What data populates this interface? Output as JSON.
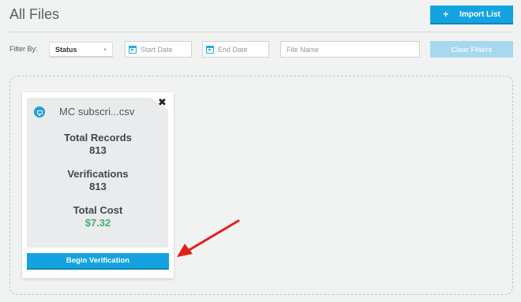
{
  "header": {
    "title": "All Files",
    "import_label": "Import List",
    "import_icon": "plus-icon"
  },
  "filters": {
    "label": "Filter By:",
    "status_value": "Status",
    "start_date_placeholder": "Start Date",
    "end_date_placeholder": "End Date",
    "file_name_placeholder": "File Name",
    "clear_label": "Clear Filters"
  },
  "card": {
    "file_name": "MC subscri...csv",
    "total_records_label": "Total Records",
    "total_records_value": "813",
    "verifications_label": "Verifications",
    "verifications_value": "813",
    "total_cost_label": "Total Cost",
    "total_cost_value": "$7.32",
    "begin_label": "Begin Verification"
  },
  "colors": {
    "accent": "#14a3e0",
    "cost_green": "#45b070",
    "annotation_arrow": "#e0201b"
  }
}
